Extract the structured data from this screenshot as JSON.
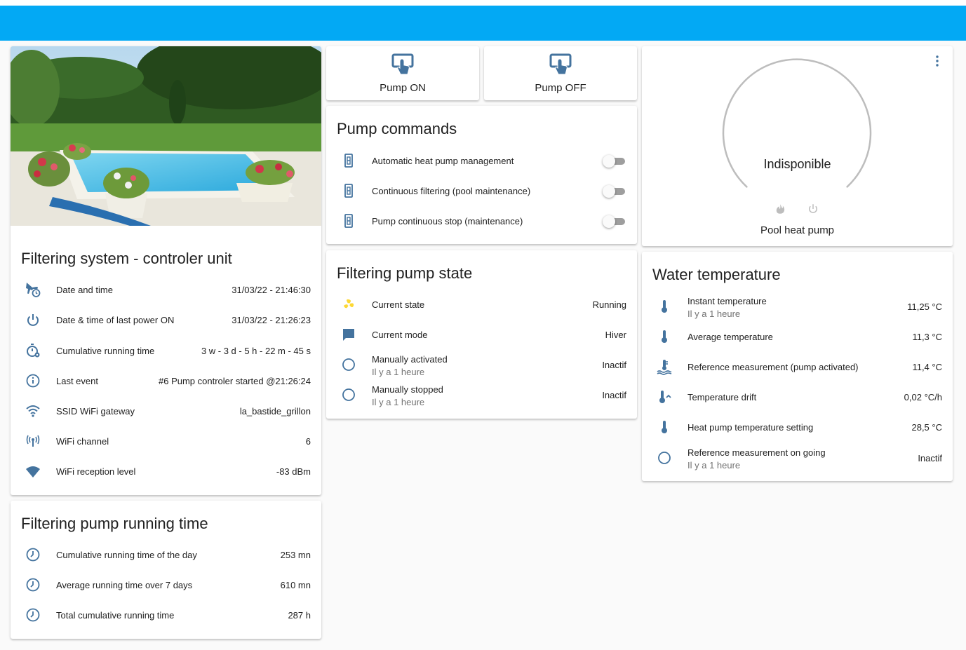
{
  "colors": {
    "header": "#03a9f4",
    "icon": "#44739e",
    "state_active": "#fdd835",
    "text": "#212121",
    "secondary": "#727272"
  },
  "control_card": {
    "image_icon": "pool-photo",
    "title": "Filtering system - controler unit",
    "rows": [
      {
        "icon": "plane-clock-icon",
        "label": "Date and time",
        "value": "31/03/22 - 21:46:30"
      },
      {
        "icon": "power-icon",
        "label": "Date & time of last power ON",
        "value": "31/03/22 - 21:26:23"
      },
      {
        "icon": "timer-cog-icon",
        "label": "Cumulative running time",
        "value": "3 w - 3 d - 5 h - 22 m - 45 s"
      },
      {
        "icon": "info-icon",
        "label": "Last event",
        "value": "#6 Pump controler started @21:26:24"
      },
      {
        "icon": "wifi-icon",
        "label": "SSID WiFi gateway",
        "value": "la_bastide_grillon"
      },
      {
        "icon": "antenna-icon",
        "label": "WiFi channel",
        "value": "6"
      },
      {
        "icon": "wifi-strength-icon",
        "label": "WiFi reception level",
        "value": "-83 dBm"
      }
    ]
  },
  "runtime_card": {
    "title": "Filtering pump running time",
    "rows": [
      {
        "icon": "clock-icon",
        "label": "Cumulative running time of the day",
        "value": "253 mn"
      },
      {
        "icon": "clock-icon",
        "label": "Average running time over 7 days",
        "value": "610 mn"
      },
      {
        "icon": "clock-icon",
        "label": "Total cumulative running time",
        "value": "287 h"
      }
    ]
  },
  "buttons": {
    "pump_on": {
      "icon": "gesture-tap-button-icon",
      "label": "Pump ON"
    },
    "pump_off": {
      "icon": "gesture-tap-button-icon",
      "label": "Pump OFF"
    }
  },
  "commands_card": {
    "title": "Pump commands",
    "rows": [
      {
        "icon": "light-switch-icon",
        "label": "Automatic heat pump management",
        "on": false
      },
      {
        "icon": "light-switch-icon",
        "label": "Continuous filtering (pool maintenance)",
        "on": false
      },
      {
        "icon": "light-switch-icon",
        "label": "Pump continuous stop (maintenance)",
        "on": false
      }
    ]
  },
  "state_card": {
    "title": "Filtering pump state",
    "rows": [
      {
        "icon": "fan-icon",
        "label": "Current state",
        "value": "Running"
      },
      {
        "icon": "message-icon",
        "label": "Current mode",
        "value": "Hiver"
      },
      {
        "icon": "circle-outline-icon",
        "label": "Manually activated",
        "sub": "Il y a 1 heure",
        "value": "Inactif"
      },
      {
        "icon": "circle-outline-icon",
        "label": "Manually stopped",
        "sub": "Il y a 1 heure",
        "value": "Inactif"
      }
    ]
  },
  "thermostat_card": {
    "status": "Indisponible",
    "name": "Pool heat pump",
    "menu_icon": "dots-vertical-icon",
    "mode_icons": [
      "fire-icon",
      "power-icon"
    ]
  },
  "water_card": {
    "title": "Water temperature",
    "rows": [
      {
        "icon": "thermometer-icon",
        "label": "Instant temperature",
        "sub": "Il y a 1 heure",
        "value": "11,25 °C"
      },
      {
        "icon": "thermometer-icon",
        "label": "Average temperature",
        "value": "11,3 °C"
      },
      {
        "icon": "thermometer-water-icon",
        "label": "Reference measurement (pump activated)",
        "value": "11,4 °C"
      },
      {
        "icon": "thermometer-chevron-up-icon",
        "label": "Temperature drift",
        "value": "0,02 °C/h"
      },
      {
        "icon": "thermometer-icon",
        "label": "Heat pump temperature setting",
        "value": "28,5 °C"
      },
      {
        "icon": "circle-outline-icon",
        "label": "Reference measurement on going",
        "sub": "Il y a 1 heure",
        "value": "Inactif"
      }
    ]
  }
}
